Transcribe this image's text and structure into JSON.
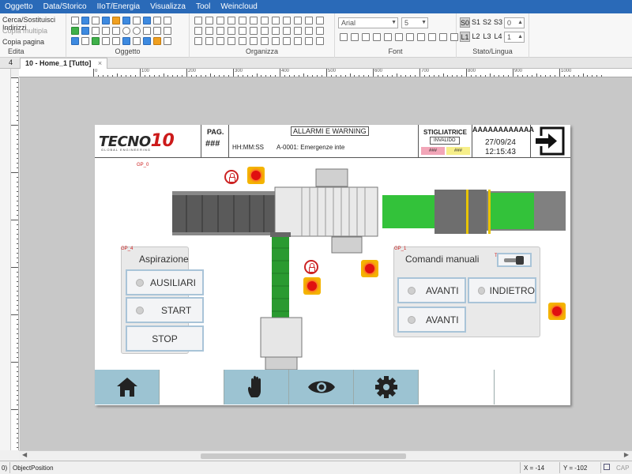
{
  "menubar": {
    "items": [
      "Oggetto",
      "Data/Storico",
      "IIoT/Energia",
      "Visualizza",
      "Tool",
      "Weincloud"
    ]
  },
  "ribbon": {
    "edita": {
      "find": "Cerca/Sostituisci Indirizzi",
      "copy_multi": "Copia multipla",
      "copy_page": "Copia pagina",
      "label": "Edita"
    },
    "oggetto": {
      "label": "Oggetto"
    },
    "organizza": {
      "label": "Organizza"
    },
    "font": {
      "family": "Arial",
      "size": "5",
      "label": "Font"
    },
    "stato": {
      "states": [
        "S0",
        "S1",
        "S2",
        "S3"
      ],
      "state_value": "0",
      "langs": [
        "L1",
        "L2",
        "L3",
        "L4"
      ],
      "lang_value": "1",
      "label": "Stato/Lingua"
    }
  },
  "tabs": {
    "index": "4",
    "active": "10 - Home_1 [Tutto]",
    "close": "×"
  },
  "ruler": {
    "top": [
      "0",
      "100",
      "200",
      "300",
      "400",
      "500",
      "600",
      "700",
      "800",
      "900",
      "1000"
    ]
  },
  "hmi": {
    "header": {
      "logo_main": "TECNO",
      "logo_num": "10",
      "logo_sub": "GLOBAL ENGINEERING",
      "pag_label": "PAG.",
      "pag_value": "###",
      "alarm_title": "ALLARMI E WARNING",
      "time_placeholder": "HH:MM:SS",
      "alarm_text": "A-0001: Emergenze inte",
      "machine": "STIGLIATRICE",
      "machine_status": "INVALIDO",
      "val1": "###",
      "val2": "###",
      "user": "AAAAAAAAAAAA",
      "date": "27/09/24",
      "time": "12:15:43"
    },
    "gp0": "GP_0",
    "aspirazione": {
      "group": "GP_4",
      "title": "Aspirazione",
      "buttons": [
        {
          "id": "TS_3",
          "label": "AUSILIARI",
          "lamp": true
        },
        {
          "id": "TS_4",
          "label": "START",
          "lamp": true
        },
        {
          "id": "TS_5",
          "label": "STOP",
          "lamp": false
        }
      ]
    },
    "comandi": {
      "group": "GP_1",
      "title": "Comandi manuali",
      "toggle_id": "TS_2",
      "buttons": [
        {
          "id": "TS_0",
          "label": "AVANTI"
        },
        {
          "id": "TS_1",
          "label": "INDIETRO"
        },
        {
          "id": "TS_6",
          "label": "AVANTI"
        }
      ]
    },
    "nav": [
      "home-icon",
      "",
      "hand-icon",
      "eye-icon",
      "gear-icon",
      "",
      ""
    ]
  },
  "statusbar": {
    "left": "0)",
    "object": "ObjectPosition",
    "x": "X = -14",
    "y": "Y = -102",
    "cap": "CAP"
  },
  "colors": {
    "accent": "#2a6ab8",
    "hmi_blue": "#9cc3d2",
    "alarm_red": "#e01010",
    "conveyor_green": "#33c23a"
  }
}
